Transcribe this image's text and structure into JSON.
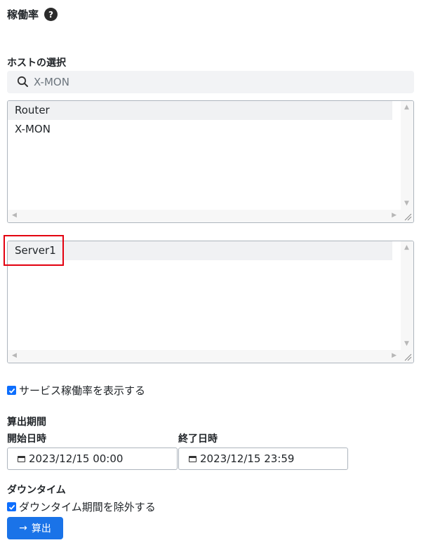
{
  "page": {
    "title": "稼働率",
    "help_glyph": "?"
  },
  "host_select": {
    "label": "ホストの選択",
    "search_value": "X-MON",
    "hosts": [
      "Router",
      "X-MON"
    ]
  },
  "services": {
    "items": [
      "Server1"
    ]
  },
  "show_service_rate": {
    "label": "サービス稼働率を表示する",
    "checked": true
  },
  "period": {
    "label": "算出期間",
    "start_label": "開始日時",
    "start_value": "2023/12/15 00:00",
    "end_label": "終了日時",
    "end_value": "2023/12/15 23:59"
  },
  "downtime": {
    "label": "ダウンタイム",
    "exclude_label": "ダウンタイム期間を除外する",
    "checked": true
  },
  "calc_button": {
    "label": "算出",
    "arrow": "→"
  },
  "colors": {
    "accent": "#1a73e8",
    "highlight": "#e3000f"
  }
}
